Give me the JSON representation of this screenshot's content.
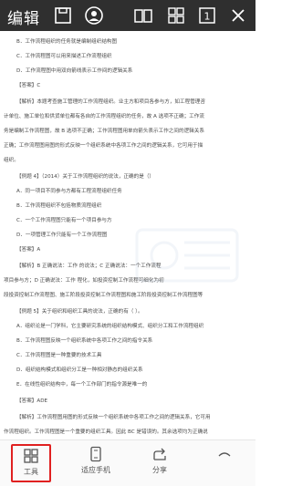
{
  "toolbar": {
    "title": "编辑"
  },
  "document_lines": [
    "B．工作流程组织的任务就是编制组织结构图",
    "C．工作流程图可以用来描述工作流程组织",
    "D．工作流程图中用双向箭线表示工作间的逻辑关系",
    "【答案】C",
    "【解析】本题考查施工管理的工作流程组织。业主方和项目各参与方，如工程管理咨",
    "计单位、施工单位和供货单位都有各自的工作流程组织的任务，故 A 选项不正确；工作流",
    "务是编制工作流程图，故 B 选项不正确；工作流程图用单向箭头表示工作之间的逻辑关系",
    "正确；工作流程图用图的形式反映一个组织系统中各项工作之间的逻辑关系，它可用于描",
    "组织。",
    "【例题 4】（2014）关于工作流程组织的说法，正确的是（）",
    "A．同一项目不同参与方都有工程流程组织任务",
    "B．工作流程组织不包括物质流程组织",
    "C．一个工作流程图只能有一个项目参与方",
    "D．一项管理工作只能有一个工作流程图",
    "【答案】A",
    "【解析】B 正确说法：工作                                  的说法；C 正确说法：一个工作流程",
    "项目参与方；D 正确说法：工作                                  程化，如投资控制工作流程可细化为初",
    "段投资控制工作流程图、施工阶段投资控制工作流程图和施工阶段投资控制工作流程图等",
    "【例题 5】关于组织和组织工具的说法，正确的有（    ）。",
    "A．组织论是一门学科，它主要研究系统的组织结构模式、组织分工和工作流程组织",
    "B．工作流程图反映一个组织系统中各项工作之间的指令关系",
    "C．工作流程图是一种重要的技术工具",
    "D．组织结构模式和组织分工是一种相对静态的组织关系",
    "E．在线性组织结构中，每一个工作部门的指令源是唯一的",
    "【答案】ADE",
    "【解析】工作流程图用图的形式反映一个组织系统中各项工作之间的逻辑关系，它可用",
    "作流程组织。工作流程图是一个重要的组织工具。因此 BC 是错误的。其余选项均为正确说"
  ],
  "bottom_buttons": [
    {
      "label": "工具",
      "icon": "grid-icon",
      "active": true
    },
    {
      "label": "适应手机",
      "icon": "phone-fit-icon",
      "active": false
    },
    {
      "label": "分享",
      "icon": "share-icon",
      "active": false
    },
    {
      "label": "",
      "icon": "collapse-icon",
      "active": false
    }
  ],
  "colors": {
    "topbar": "#2f2f2f",
    "active_border": "#e02020",
    "text": "#4a4a4a"
  }
}
